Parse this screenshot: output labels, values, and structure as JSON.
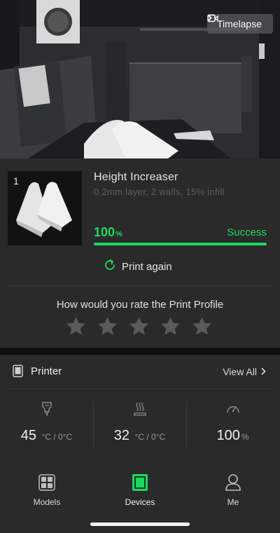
{
  "camera": {
    "timelapse_label": "Timelapse"
  },
  "job": {
    "index": "1",
    "name": "Height Increaser",
    "description": "0.2mm layer, 2 walls, 15% infill",
    "progress_value": "100",
    "progress_unit": "%",
    "progress_fraction": 1.0,
    "status": "Success"
  },
  "actions": {
    "print_again_label": "Print again"
  },
  "rating": {
    "title": "How would you rate the Print Profile",
    "max_stars": 5,
    "value": 0
  },
  "printer": {
    "title": "Printer",
    "view_all_label": "View All",
    "stats": {
      "nozzle": {
        "value": "45",
        "unit": "°C / 0°C"
      },
      "bed": {
        "value": "32",
        "unit": "°C / 0°C"
      },
      "speed": {
        "value": "100",
        "unit": "%"
      }
    }
  },
  "tabs": {
    "models": "Models",
    "devices": "Devices",
    "me": "Me"
  },
  "colors": {
    "accent": "#1ed760",
    "card": "#2a2a2b",
    "background": "#0f0f10"
  }
}
